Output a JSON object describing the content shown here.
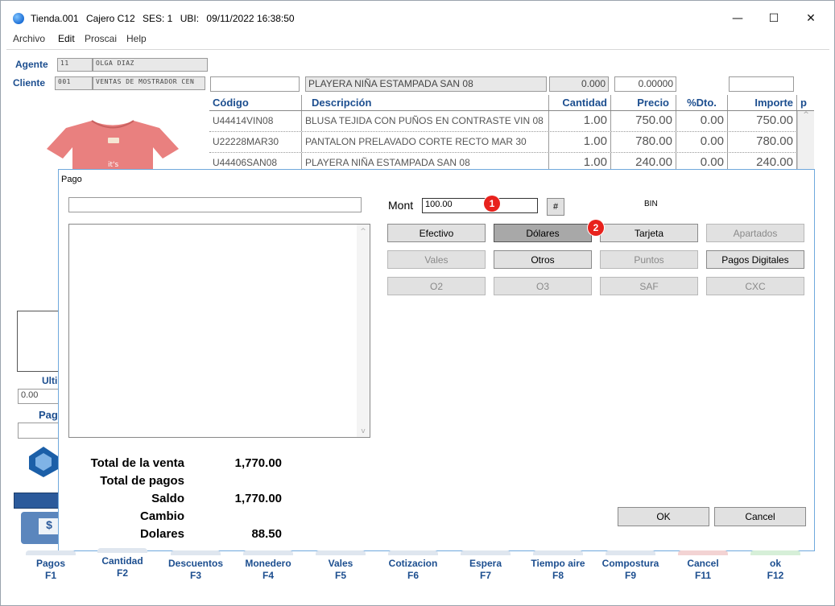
{
  "window": {
    "app": "Tienda.001",
    "cashier": "Cajero C12",
    "session": "SES: 1",
    "location": "UBI:",
    "timestamp": "09/11/2022 16:38:50",
    "minimize": "—",
    "maximize": "☐",
    "close": "✕"
  },
  "menu": [
    "Archivo",
    "Edit",
    "Proscai",
    "Help"
  ],
  "form": {
    "agente_label": "Agente",
    "agente_code": "11",
    "agente_name": "OLGA DIAZ",
    "cliente_label": "Cliente",
    "cliente_code": "001",
    "cliente_name": "VENTAS DE MOSTRADOR CEN",
    "search_value": "",
    "selected_desc": "PLAYERA NIÑA ESTAMPADA SAN 08",
    "qty_field": "0.000",
    "price_field": "0.00000",
    "extra_field": ""
  },
  "grid": {
    "headers": [
      "Código",
      "Descripción",
      "Cantidad",
      "Precio",
      "%Dto.",
      "Importe",
      "p"
    ],
    "rows": [
      {
        "codigo": "U44414VIN08",
        "descripcion": "BLUSA TEJIDA CON PUÑOS EN CONTRASTE VIN 08",
        "cantidad": "1.00",
        "precio": "750.00",
        "dto": "0.00",
        "importe": "750.00"
      },
      {
        "codigo": "U22228MAR30",
        "descripcion": "PANTALON PRELAVADO CORTE RECTO MAR 30",
        "cantidad": "1.00",
        "precio": "780.00",
        "dto": "0.00",
        "importe": "780.00"
      },
      {
        "codigo": "U44406SAN08",
        "descripcion": "PLAYERA NIÑA ESTAMPADA SAN 08",
        "cantidad": "1.00",
        "precio": "240.00",
        "dto": "0.00",
        "importe": "240.00"
      }
    ]
  },
  "left_panel": {
    "ultimo_label": "Ulti",
    "ultimo_value": "0.00",
    "pago_label": "Pag",
    "cash_glyph": "$"
  },
  "dialog": {
    "title": "Pago",
    "top_field": "",
    "mont_label": "Mont",
    "mont_value": "100.00",
    "hash_button": "#",
    "bin_label": "BIN",
    "badge1": "1",
    "badge2": "2",
    "buttons": [
      {
        "label": "Efectivo",
        "state": "enabled"
      },
      {
        "label": "Dólares",
        "state": "pressed"
      },
      {
        "label": "Tarjeta",
        "state": "enabled"
      },
      {
        "label": "Apartados",
        "state": "disabled"
      },
      {
        "label": "Vales",
        "state": "disabled"
      },
      {
        "label": "Otros",
        "state": "enabled"
      },
      {
        "label": "Puntos",
        "state": "disabled"
      },
      {
        "label": "Pagos Digitales",
        "state": "enabled"
      },
      {
        "label": "O2",
        "state": "disabled"
      },
      {
        "label": "O3",
        "state": "disabled"
      },
      {
        "label": "SAF",
        "state": "disabled"
      },
      {
        "label": "CXC",
        "state": "disabled"
      }
    ],
    "totals": [
      {
        "label": "Total de la venta",
        "value": "1,770.00"
      },
      {
        "label": "Total de pagos",
        "value": ""
      },
      {
        "label": "Saldo",
        "value": "1,770.00"
      },
      {
        "label": "Cambio",
        "value": ""
      },
      {
        "label": "Dolares",
        "value": "88.50"
      }
    ],
    "ok": "OK",
    "cancel": "Cancel"
  },
  "function_keys": [
    {
      "label": "Pagos",
      "key": "F1",
      "tab_color": "#dfe6ef"
    },
    {
      "label": "Cantidad",
      "key": "F2",
      "tab_color": "#dfe6ef"
    },
    {
      "label": "Descuentos",
      "key": "F3",
      "tab_color": "#dfe6ef"
    },
    {
      "label": "Monedero",
      "key": "F4",
      "tab_color": "#dfe6ef"
    },
    {
      "label": "Vales",
      "key": "F5",
      "tab_color": "#dfe6ef"
    },
    {
      "label": "Cotizacion",
      "key": "F6",
      "tab_color": "#dfe6ef"
    },
    {
      "label": "Espera",
      "key": "F7",
      "tab_color": "#dfe6ef"
    },
    {
      "label": "Tiempo aire",
      "key": "F8",
      "tab_color": "#dfe6ef"
    },
    {
      "label": "Compostura",
      "key": "F9",
      "tab_color": "#dfe6ef"
    },
    {
      "label": "Cancel",
      "key": "F11",
      "tab_color": "#f3d3d3"
    },
    {
      "label": "ok",
      "key": "F12",
      "tab_color": "#d6efd8"
    }
  ]
}
